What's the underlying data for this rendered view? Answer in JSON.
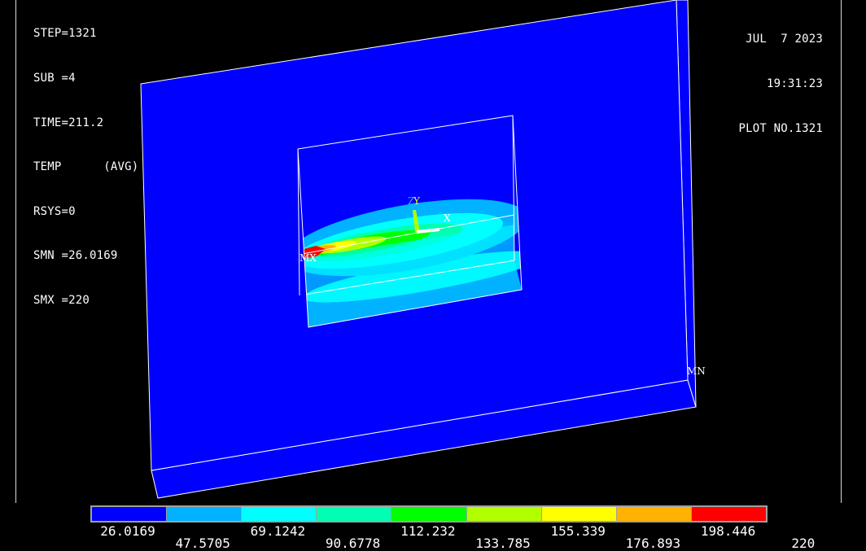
{
  "info": {
    "left": [
      "STEP=1321",
      "SUB =4",
      "TIME=211.2",
      "TEMP      (AVG)",
      "RSYS=0",
      "SMN =26.0169",
      "SMX =220"
    ],
    "right": [
      "JUL  7 2023",
      "19:31:23",
      "PLOT NO.1321"
    ]
  },
  "markers": {
    "mx": "MX",
    "mn": "MN",
    "axis_z": "Z",
    "axis_y": "Y",
    "axis_x": "X"
  },
  "legend": {
    "colors": [
      "#0000ff",
      "#00b2ff",
      "#00ffff",
      "#00ffb2",
      "#00ff00",
      "#b2ff00",
      "#ffff00",
      "#ffb200",
      "#ff0000"
    ],
    "labels_top": [
      "26.0169",
      "69.1242",
      "112.232",
      "155.339",
      "198.446"
    ],
    "labels_bottom": [
      "47.5705",
      "90.6778",
      "133.785",
      "176.893",
      "220"
    ]
  },
  "palette": {
    "background": "#000000",
    "plate": "#0000ff",
    "edge": "#ffffff"
  }
}
